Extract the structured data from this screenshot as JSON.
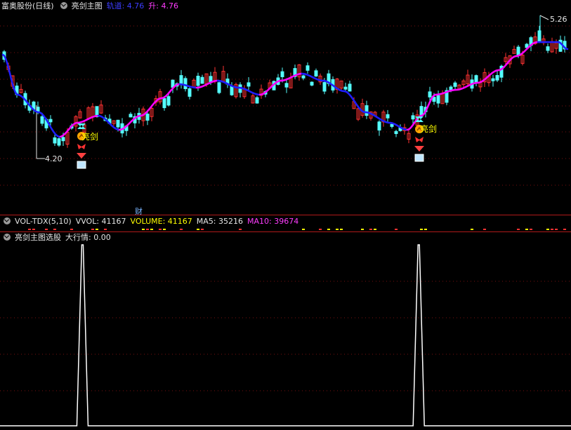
{
  "main_header": {
    "stock": "富奥股份(日线)",
    "indicator": "亮剑主图",
    "track_label": "轨道: 4.76",
    "up_label": "升: 4.76"
  },
  "annotations": {
    "high_price": "5.26",
    "low_price": "4.20",
    "signal_text_1": "亮剑",
    "signal_text_2": "亮剑",
    "finance_marker": "财"
  },
  "vol_header": {
    "name": "VOL-TDX(5,10)",
    "vvol": "VVOL: 41167",
    "volume": "VOLUME: 41167",
    "ma5": "MA5: 35216",
    "ma10": "MA10: 39674"
  },
  "signal_header": {
    "name": "亮剑主图选股",
    "value": "大行情: 0.00"
  },
  "colors": {
    "up": "#ff3232",
    "down": "#54fcfc",
    "track_blue": "#1e1eff",
    "up_magenta": "#ff00ff",
    "volume_yellow": "#ffff00",
    "grid": "#7a1010"
  },
  "chart_data": [
    {
      "type": "candlestick",
      "title": "亮剑主图",
      "series": [
        {
          "name": "轨道",
          "last": 4.76
        },
        {
          "name": "升",
          "last": 4.76
        }
      ],
      "ylim": [
        4.0,
        5.3
      ],
      "price_labels": [
        5.26,
        4.2
      ],
      "grid": true
    },
    {
      "type": "line",
      "title": "亮剑主图选股",
      "series": [
        {
          "name": "大行情",
          "last": 0.0
        }
      ],
      "spike_positions_bar_index": [
        39,
        198
      ],
      "bar_count": 270
    }
  ]
}
